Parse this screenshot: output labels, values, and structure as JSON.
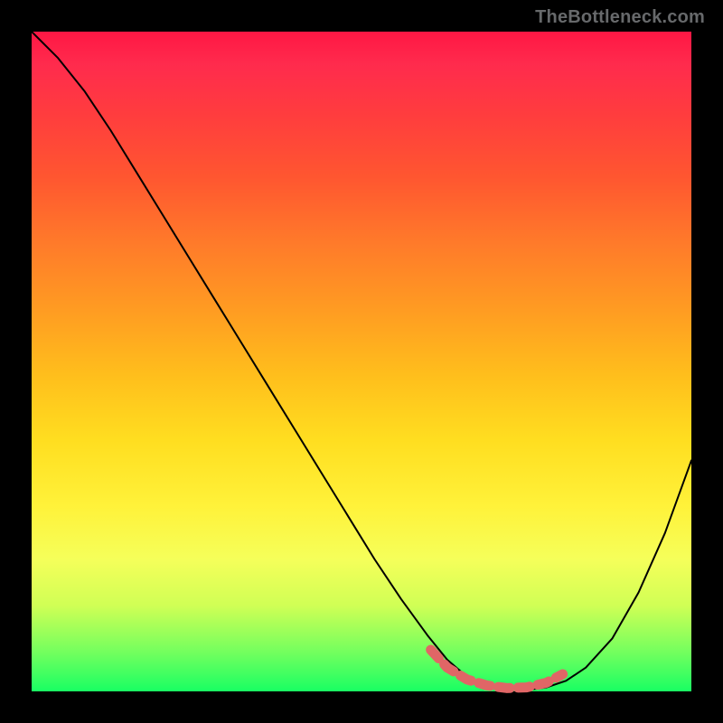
{
  "watermark": "TheBottleneck.com",
  "chart_data": {
    "type": "line",
    "title": "",
    "xlabel": "",
    "ylabel": "",
    "xlim": [
      0,
      100
    ],
    "ylim": [
      0,
      100
    ],
    "series": [
      {
        "name": "curve-black",
        "stroke": "#000000",
        "stroke_width": 2,
        "x": [
          0,
          4,
          8,
          12,
          16,
          20,
          24,
          28,
          32,
          36,
          40,
          44,
          48,
          52,
          56,
          60,
          63,
          66,
          69,
          72,
          75,
          78,
          81,
          84,
          88,
          92,
          96,
          100
        ],
        "y": [
          100,
          96,
          91,
          85,
          78.5,
          72,
          65.5,
          59,
          52.5,
          46,
          39.5,
          33,
          26.5,
          20,
          14,
          8.5,
          4.8,
          2.2,
          0.8,
          0.2,
          0.2,
          0.6,
          1.6,
          3.6,
          8,
          15,
          24,
          35
        ]
      },
      {
        "name": "beads-red",
        "stroke": "#e06666",
        "stroke_width": 11,
        "dash": [
          13,
          9
        ],
        "x": [
          60.5,
          63,
          66,
          69,
          72,
          75,
          78,
          80.5
        ],
        "y": [
          6.3,
          3.6,
          1.8,
          0.9,
          0.5,
          0.6,
          1.3,
          2.6
        ]
      }
    ]
  },
  "colors": {
    "bg": "#000000",
    "watermark": "#67696b",
    "gradient_stops": [
      "#ff1744",
      "#ff7a2a",
      "#ffde20",
      "#19ff63"
    ]
  }
}
